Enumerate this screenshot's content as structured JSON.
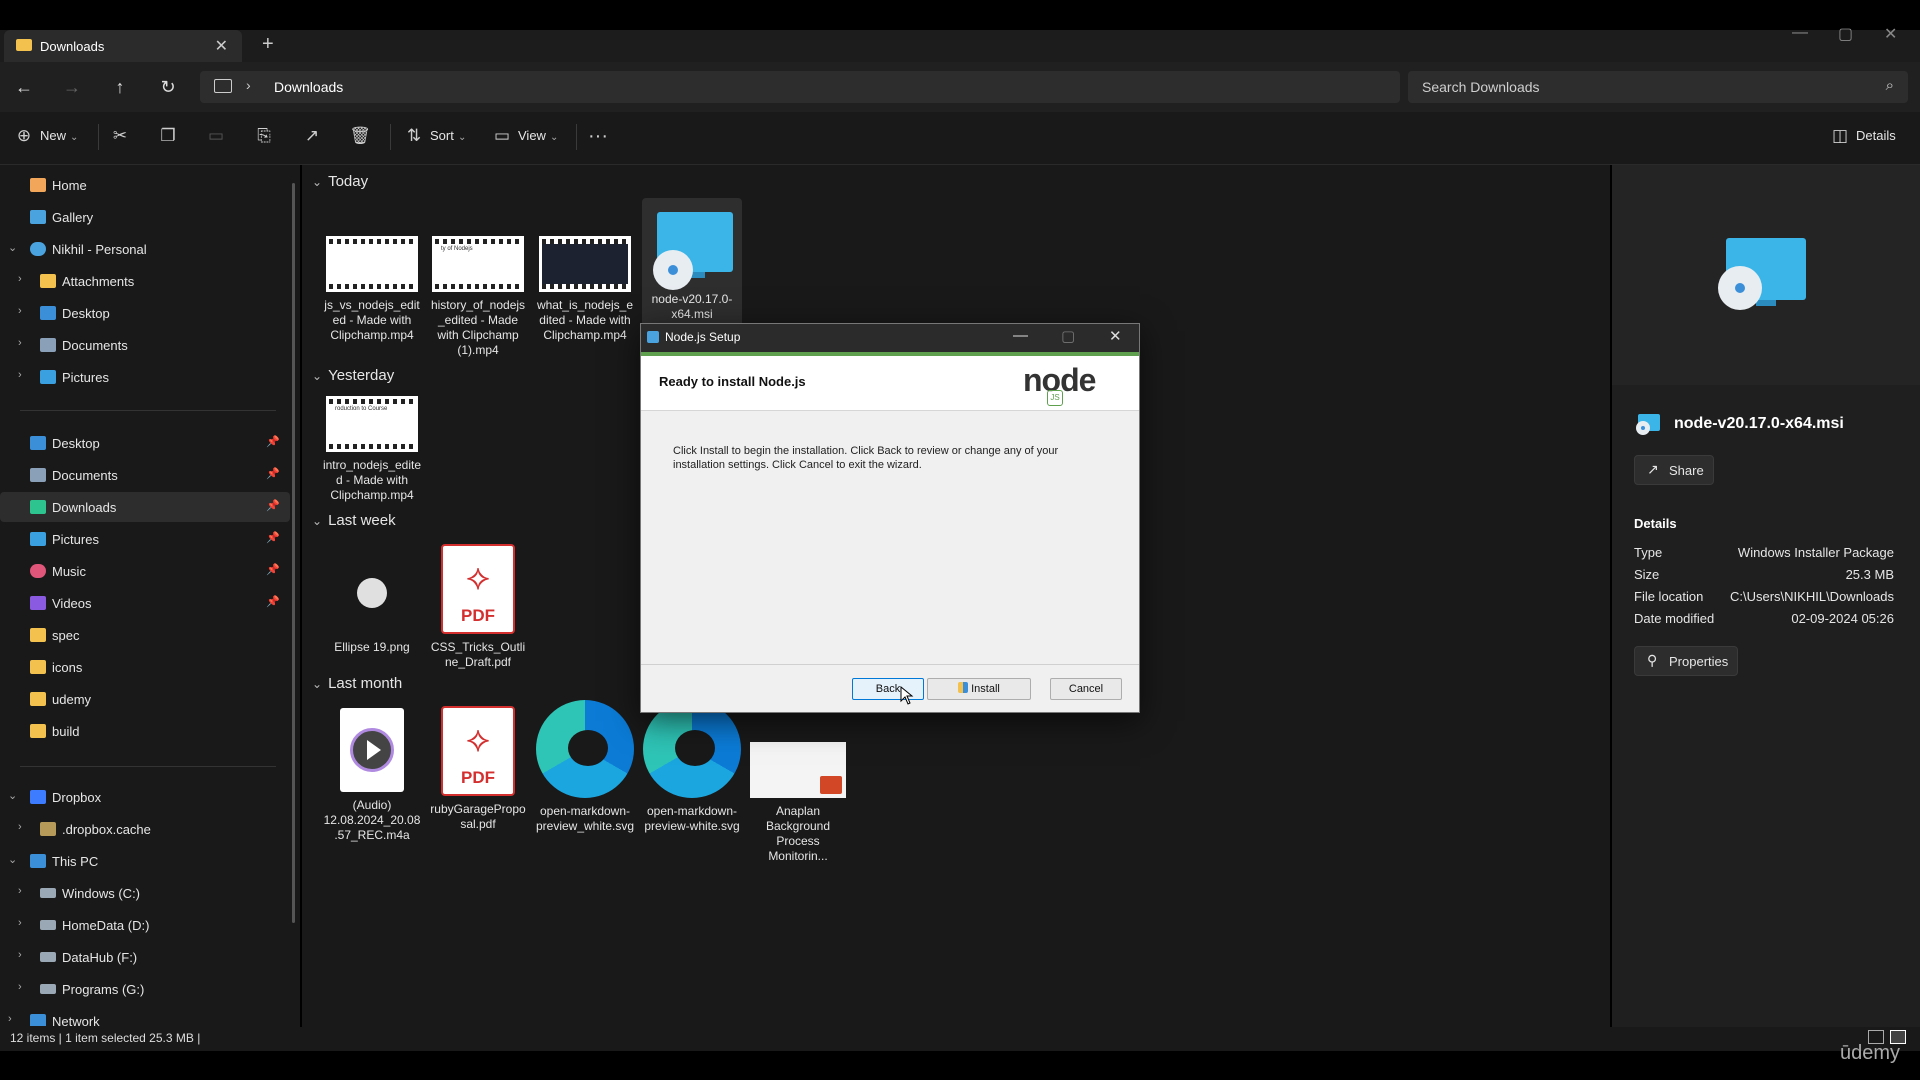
{
  "tab": {
    "title": "Downloads"
  },
  "address": {
    "segment": "Downloads",
    "search_placeholder": "Search Downloads"
  },
  "toolbar": {
    "new_label": "New",
    "sort_label": "Sort",
    "view_label": "View",
    "details_label": "Details"
  },
  "nav": {
    "quick": [
      {
        "label": "Home"
      },
      {
        "label": "Gallery"
      },
      {
        "label": "Nikhil - Personal"
      },
      {
        "label": "Attachments"
      },
      {
        "label": "Desktop"
      },
      {
        "label": "Documents"
      },
      {
        "label": "Pictures"
      }
    ],
    "pinned": [
      {
        "label": "Desktop"
      },
      {
        "label": "Documents"
      },
      {
        "label": "Downloads"
      },
      {
        "label": "Pictures"
      },
      {
        "label": "Music"
      },
      {
        "label": "Videos"
      },
      {
        "label": "spec"
      },
      {
        "label": "icons"
      },
      {
        "label": "udemy"
      },
      {
        "label": "build"
      }
    ],
    "drives": [
      {
        "label": "Dropbox"
      },
      {
        "label": ".dropbox.cache"
      },
      {
        "label": "This PC"
      },
      {
        "label": "Windows (C:)"
      },
      {
        "label": "HomeData (D:)"
      },
      {
        "label": "DataHub (F:)"
      },
      {
        "label": "Programs (G:)"
      },
      {
        "label": "Network"
      }
    ]
  },
  "groups": {
    "today": "Today",
    "yesterday": "Yesterday",
    "last_week": "Last week",
    "last_month": "Last month"
  },
  "files": {
    "f1": "js_vs_nodejs_edited - Made with Clipchamp.mp4",
    "f2": "history_of_nodejs_edited - Made with Clipchamp (1).mp4",
    "f3": "what_is_nodejs_edited - Made with Clipchamp.mp4",
    "f4": "node-v20.17.0-x64.msi",
    "f5": "intro_nodejs_edited - Made with Clipchamp.mp4",
    "f6": "Ellipse 19.png",
    "f7": "CSS_Tricks_Outline_Draft.pdf",
    "f8": "(Audio) 12.08.2024_20.08.57_REC.m4a",
    "f9": "rubyGarageProposal.pdf",
    "f10": "open-markdown-preview_white.svg",
    "f11": "open-markdown-preview-white.svg",
    "f12": "Anaplan Background Process Monitorin..."
  },
  "thumb_text": {
    "t1": "ty of Nodejs",
    "t2": "roduction to Course"
  },
  "pdf_label": "PDF",
  "details": {
    "filename": "node-v20.17.0-x64.msi",
    "share": "Share",
    "heading": "Details",
    "type_k": "Type",
    "type_v": "Windows Installer Package",
    "size_k": "Size",
    "size_v": "25.3 MB",
    "loc_k": "File location",
    "loc_v": "C:\\Users\\NIKHIL\\Downloads",
    "date_k": "Date modified",
    "date_v": "02-09-2024 05:26",
    "properties": "Properties"
  },
  "status": {
    "text": "12 items  |  1 item selected  25.3 MB  |"
  },
  "watermark": "ūdemy",
  "dialog": {
    "title": "Node.js Setup",
    "heading": "Ready to install Node.js",
    "body": "Click Install to begin the installation. Click Back to review or change any of your installation settings. Click Cancel to exit the wizard.",
    "back": "Back",
    "install": "Install",
    "cancel": "Cancel",
    "logo_text": "node",
    "logo_sub": "JS"
  }
}
